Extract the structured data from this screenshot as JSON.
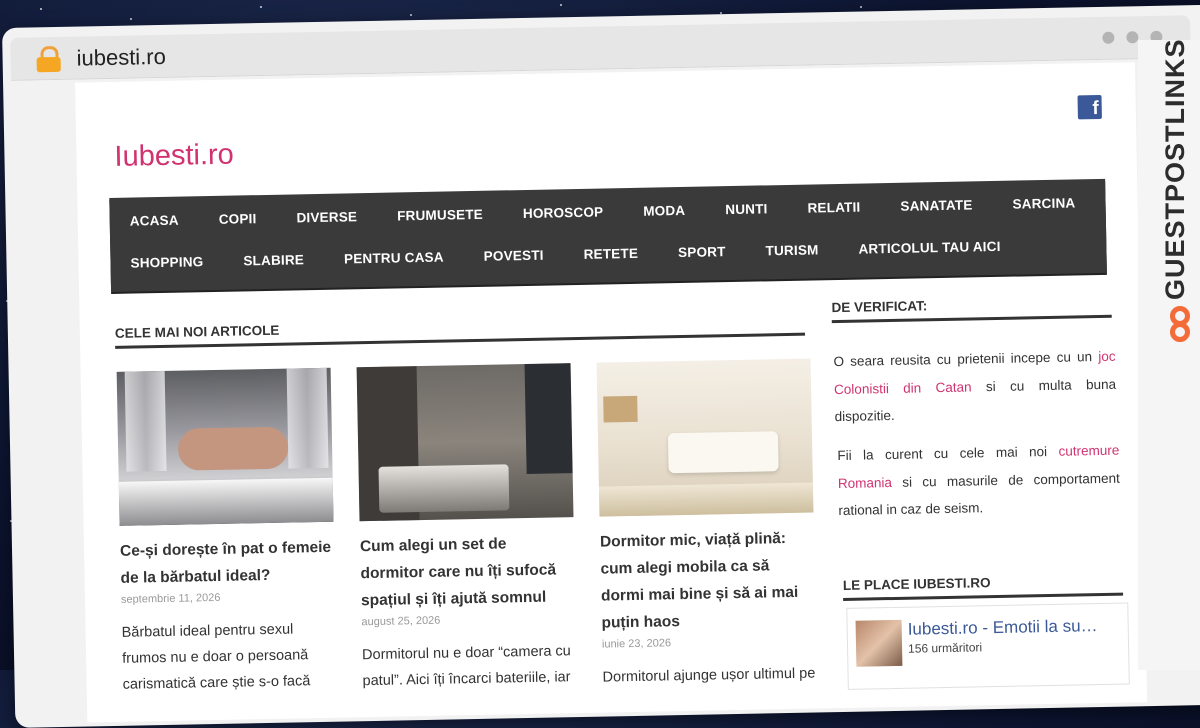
{
  "browser": {
    "url": "iubesti.ro",
    "colors": {
      "lock": "#f5a623",
      "window_dot": "#b4b4b4"
    }
  },
  "site": {
    "title": "Iubesti.ro",
    "brand_color": "#d0336f",
    "facebook_icon": "facebook-icon"
  },
  "nav": {
    "row1": [
      "ACASA",
      "COPII",
      "DIVERSE",
      "FRUMUSETE",
      "HOROSCOP",
      "MODA",
      "NUNTI",
      "RELATII",
      "SANATATE",
      "SARCINA"
    ],
    "row2": [
      "SHOPPING",
      "SLABIRE",
      "PENTRU CASA",
      "POVESTI",
      "RETETE",
      "SPORT",
      "TURISM",
      "ARTICOLUL TAU AICI"
    ]
  },
  "latest": {
    "heading": "CELE MAI NOI ARTICOLE",
    "articles": [
      {
        "title": "Ce-și dorește în pat o femeie de la bărbatul ideal?",
        "date": "septembrie 11, 2026",
        "excerpt": "Bărbatul ideal pentru sexul frumos nu e doar o persoană carismatică care știe s-o facă"
      },
      {
        "title": "Cum alegi un set de dormitor care nu îți sufocă spațiul și îți ajută somnul",
        "date": "august 25, 2026",
        "excerpt": "Dormitorul nu e doar “camera cu patul”. Aici îți încarci bateriile, iar"
      },
      {
        "title": "Dormitor mic, viață plină: cum alegi mobila ca să dormi mai bine și să ai mai puțin haos",
        "date": "iunie 23, 2026",
        "excerpt": "Dormitorul ajunge ușor ultimul pe"
      }
    ]
  },
  "sidebar": {
    "verify": {
      "heading": "DE VERIFICAT:",
      "p1_before": "O seara reusita cu prietenii incepe cu un ",
      "p1_link": "joc Colonistii din Catan",
      "p1_after": " si cu multa buna dispozitie.",
      "p2_before": "Fii la curent cu cele mai noi ",
      "p2_link": "cutremure Romania",
      "p2_after": " si cu masurile de comportament rational in caz de seism."
    },
    "likes": {
      "heading": "LE PLACE IUBESTI.RO",
      "page_name": "Iubesti.ro - Emotii la su…",
      "followers": "156 urmăritori"
    }
  },
  "banner": {
    "text": "GUESTPOSTLINKS",
    "logo_color": "#f26b38"
  }
}
